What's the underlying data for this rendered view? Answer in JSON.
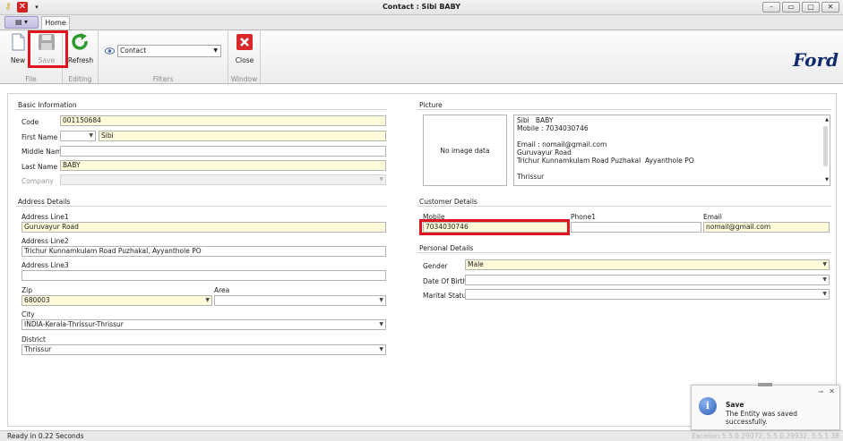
{
  "window": {
    "title": "Contact : Sibi  BABY",
    "buttons": [
      "–",
      "▭",
      "▢",
      "✕"
    ]
  },
  "tabs": {
    "home": "Home"
  },
  "ribbon": {
    "new_label": "New",
    "save_label": "Save",
    "refresh_label": "Refresh",
    "close_label": "Close",
    "filter_value": "Contact",
    "groups": {
      "file": "File",
      "editing": "Editing",
      "filters": "Filters",
      "window": "Window"
    }
  },
  "brand": {
    "logo": "Ford"
  },
  "basic": {
    "title": "Basic Information",
    "code_label": "Code",
    "code": "001150684",
    "first_name_label": "First Name",
    "salutation": "",
    "first_name": "Sibi",
    "middle_name_label": "Middle Name",
    "middle_name": "",
    "last_name_label": "Last Name",
    "last_name": "BABY",
    "company_label": "Company",
    "company": ""
  },
  "address": {
    "title": "Address Details",
    "line1_label": "Address Line1",
    "line1": "Guruvayur Road",
    "line2_label": "Address Line2",
    "line2": "Trichur Kunnamkulam Road Puzhakal, Ayyanthole PO",
    "line3_label": "Address Line3",
    "line3": "",
    "zip_label": "Zip",
    "zip": "680003",
    "area_label": "Area",
    "area": "",
    "city_label": "City",
    "city": "INDIA-Kerala-Thrissur-Thrissur",
    "district_label": "District",
    "district": "Thrissur"
  },
  "picture": {
    "title": "Picture",
    "placeholder": "No image data",
    "info": "Sibi   BABY\nMobile : 7034030746\n\nEmail : nomail@gmail.com\nGuruvayur Road\nTrichur Kunnamkulam Road Puzhakal  Ayyanthole PO\n\nThrissur"
  },
  "customer": {
    "title": "Customer Details",
    "mobile_label": "Mobile",
    "mobile": "7034030746",
    "phone1_label": "Phone1",
    "phone1": "",
    "email_label": "Email",
    "email": "nomail@gmail.com"
  },
  "personal": {
    "title": "Personal Details",
    "gender_label": "Gender",
    "gender": "Male",
    "dob_label": "Date Of Birth",
    "dob": "",
    "marital_label": "Marital Status",
    "marital": ""
  },
  "status": {
    "text": "Ready in 0.22 Seconds",
    "version": "Excellon 5.5.0.29072, 5.5.0.29932, 5.5.1.38"
  },
  "toast": {
    "title": "Save",
    "message": "The Entity was saved successfully."
  },
  "colors": {
    "highlight": "#e0141e",
    "required_field": "#fefbdb",
    "brand": "#102a6c"
  }
}
